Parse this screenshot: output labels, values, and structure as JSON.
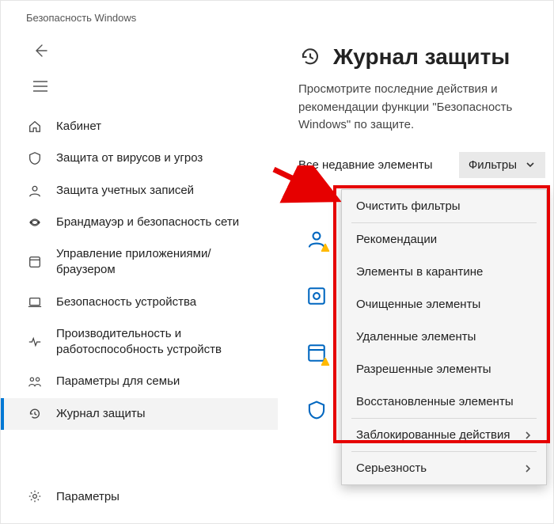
{
  "window": {
    "title": "Безопасность Windows"
  },
  "sidebar": {
    "items": [
      {
        "label": "Кабинет",
        "icon": "home-icon"
      },
      {
        "label": "Защита от вирусов и угроз",
        "icon": "shield-icon"
      },
      {
        "label": "Защита учетных записей",
        "icon": "account-icon"
      },
      {
        "label": "Брандмауэр и безопасность сети",
        "icon": "firewall-icon"
      },
      {
        "label": "Управление приложениями/браузером",
        "icon": "app-control-icon"
      },
      {
        "label": "Безопасность устройства",
        "icon": "device-icon"
      },
      {
        "label": "Производительность и работоспособность устройств",
        "icon": "health-icon"
      },
      {
        "label": "Параметры для семьи",
        "icon": "family-icon"
      },
      {
        "label": "Журнал защиты",
        "icon": "history-icon"
      }
    ],
    "footer": {
      "label": "Параметры",
      "icon": "gear-icon"
    }
  },
  "page": {
    "title": "Журнал защиты",
    "subtitle": "Просмотрите последние действия и рекомендации функции \"Безопасность Windows\" по защите."
  },
  "filter": {
    "all_label": "Все недавние элементы",
    "button_label": "Фильтры"
  },
  "dropdown": {
    "clear": "Очистить фильтры",
    "items": [
      "Рекомендации",
      "Элементы в карантине",
      "Очищенные элементы",
      "Удаленные элементы",
      "Разрешенные элементы",
      "Восстановленные элементы"
    ],
    "blocked": "Заблокированные действия",
    "severity": "Серьезность"
  }
}
